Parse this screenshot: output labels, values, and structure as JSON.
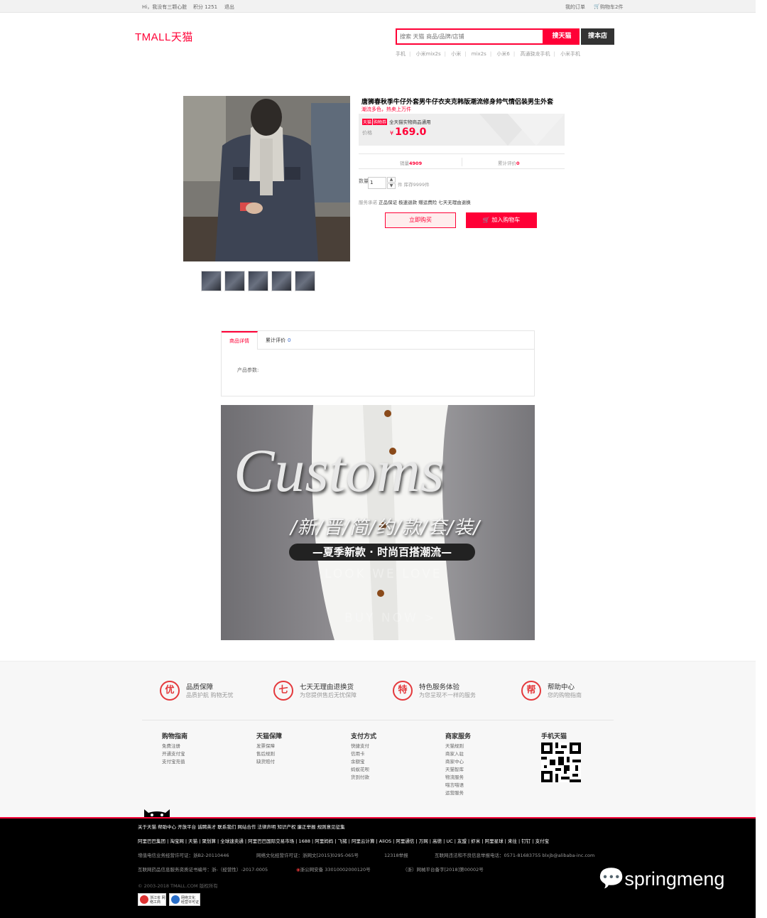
{
  "topbar": {
    "greeting": "Hi，我没有三颗心脏",
    "points": "积分 1251",
    "logout": "退出",
    "my_orders": "我的订单",
    "cart": "购物车2件"
  },
  "header": {
    "logo": "TMALL天猫",
    "search_placeholder": "搜索 天猫 商品/品牌/店铺",
    "search_tmall": "搜天猫",
    "search_shop": "搜本店",
    "hotwords": [
      "手机",
      "小米mix2s",
      "小米",
      "mix2s",
      "小米6",
      "高通骁龙手机",
      "小米手机"
    ]
  },
  "product": {
    "title": "唐狮春秋季牛仔外套男牛仔衣夹克韩版潮流修身帅气情侣装男生外套",
    "subtitle": "潮流多色，热卖上万件",
    "tag_tmall": "天猫",
    "tag_coupon": "购物券",
    "promo_text": "全天猫实物商品通用",
    "price_label": "价格",
    "currency": "¥",
    "price": "169.0",
    "sales_label": "销量",
    "sales_value": "4909",
    "reviews_label": "累计评价",
    "reviews_value": "0",
    "qty_label": "数量",
    "qty_value": "1",
    "stock_text": "件 库存9999件",
    "service_label": "服务承诺",
    "service_items": "正品保证 极速退款 赠运费险 七天无理由退换",
    "buy_now": "立即购买",
    "add_cart": "加入购物车"
  },
  "tabs": {
    "detail": "商品详情",
    "reviews": "累计评价",
    "reviews_count": "0",
    "params_label": "产品参数:"
  },
  "banner": {
    "title": "Customs",
    "subtitle": "/新/晋/简/约/款/套/装/",
    "slogan": "—夏季新款 · 时尚百搭潮流—",
    "faded1": "LOOK WE LOVE",
    "faded2": "BUY NOW >"
  },
  "features": [
    {
      "icon": "优",
      "title": "品质保障",
      "sub": "品质护航 购物无忧"
    },
    {
      "icon": "七",
      "title": "七天无理由退换货",
      "sub": "为您提供售后无忧保障"
    },
    {
      "icon": "特",
      "title": "特色服务体验",
      "sub": "为您呈现不一样的服务"
    },
    {
      "icon": "帮",
      "title": "帮助中心",
      "sub": "您的购物指南"
    }
  ],
  "footer_columns": [
    {
      "title": "购物指南",
      "items": [
        "免费注册",
        "开通支付宝",
        "支付宝充值"
      ]
    },
    {
      "title": "天猫保障",
      "items": [
        "发票保障",
        "售后规则",
        "缺货赔付"
      ]
    },
    {
      "title": "支付方式",
      "items": [
        "快捷支付",
        "信用卡",
        "余额宝",
        "蚂蚁花呗",
        "货到付款"
      ]
    },
    {
      "title": "商家服务",
      "items": [
        "天猫规则",
        "商家入驻",
        "商家中心",
        "天猫智库",
        "物流服务",
        "喵言喵语",
        "运营服务"
      ]
    },
    {
      "title": "手机天猫",
      "items": []
    }
  ],
  "footer_links": "关于天猫  帮助中心  开放平台  诚聘英才  联系我们  网站合作  法律声明  知识产权  廉正举报  规则意见征集",
  "footer_group": "阿里巴巴集团 | 淘宝网 | 天猫 | 聚划算 | 全球速卖通 | 阿里巴巴国际交易市场 | 1688 | 阿里妈妈 | 飞猪 | 阿里云计算 | AliOS | 阿里通信 | 万网 | 高德 | UC | 友盟 | 虾米 | 阿里星球 | 来往 | 钉钉 | 支付宝",
  "footer_license1": "增值电信业务经营许可证：浙B2-20110446",
  "footer_license2": "网络文化经营许可证：浙网文[2015]0295-065号",
  "footer_license3": "12318举报",
  "footer_license4": "互联网违法和不良信息举报电话：0571-81683755 blxjb@alibaba-inc.com",
  "footer_license5": "互联网药品信息服务资质证书编号：浙-（经营性）-2017-0005",
  "footer_license6": "浙公网安备 33010002000120号",
  "footer_license7": "（浙）网械平台备字[2018]第00002号",
  "footer_copyright": "© 2003-2018 TMALL.COM 版权所有",
  "badge1": "浙江省 网络工商",
  "badge2": "网络文化 经营许可证",
  "watermark": "springmeng",
  "colors": {
    "accent": "#ff0036",
    "footer_bg": "#000000"
  }
}
